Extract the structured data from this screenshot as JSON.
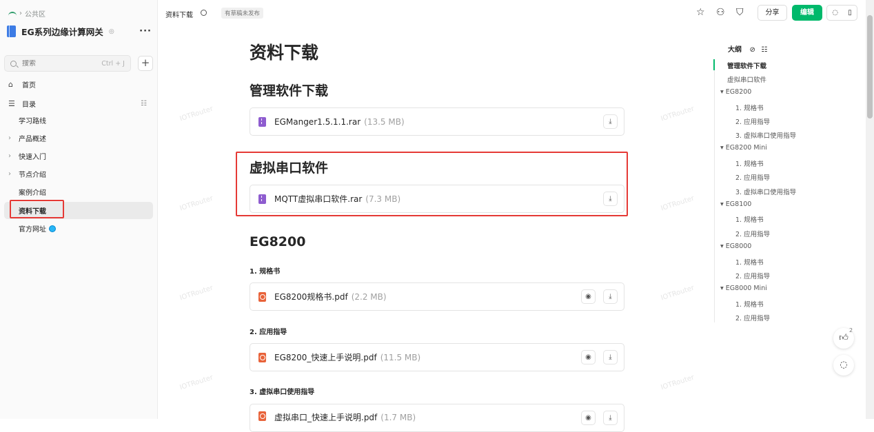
{
  "breadcrumb": {
    "workspace": "公共区"
  },
  "kb": {
    "name": "EG系列边缘计算网关",
    "more": "···"
  },
  "search": {
    "placeholder": "搜索",
    "shortcut": "Ctrl + J"
  },
  "nav": {
    "home": "首页",
    "toc": "目录"
  },
  "tree": [
    {
      "label": "学习路线",
      "arrow": ""
    },
    {
      "label": "产品概述",
      "arrow": "›"
    },
    {
      "label": "快速入门",
      "arrow": "›"
    },
    {
      "label": "节点介绍",
      "arrow": "›"
    },
    {
      "label": "案例介绍",
      "arrow": ""
    },
    {
      "label": "资料下载",
      "arrow": ""
    },
    {
      "label": "官方网址",
      "arrow": ""
    }
  ],
  "topbar": {
    "doc_title": "资料下载",
    "draft_badge": "有草稿未发布",
    "share": "分享",
    "edit": "编辑"
  },
  "content": {
    "title": "资料下载",
    "sections": {
      "mgmt": "管理软件下载",
      "serial": "虚拟串口软件",
      "eg8200": "EG8200"
    },
    "subsections": {
      "spec": "1. 规格书",
      "guide": "2. 应用指导",
      "serial_guide": "3. 虚拟串口使用指导"
    },
    "files": [
      {
        "name": "EGManger1.5.1.1.rar",
        "size": "(13.5 MB)"
      },
      {
        "name": "MQTT虚拟串口软件.rar",
        "size": "(7.3 MB)"
      },
      {
        "name": "EG8200规格书.pdf",
        "size": "(2.2 MB)"
      },
      {
        "name": "EG8200_快速上手说明.pdf",
        "size": "(11.5 MB)"
      },
      {
        "name": "虚拟串口_快速上手说明.pdf",
        "size": "(1.7 MB)"
      }
    ],
    "watermark": "IOTRouter"
  },
  "outline": {
    "title": "大纲",
    "items": [
      "管理软件下载",
      "虚拟串口软件",
      "EG8200",
      "1. 规格书",
      "2. 应用指导",
      "3. 虚拟串口使用指导",
      "EG8200 Mini",
      "1. 规格书",
      "2. 应用指导",
      "3. 虚拟串口使用指导",
      "EG8100",
      "1. 规格书",
      "2. 应用指导",
      "EG8000",
      "1. 规格书",
      "2. 应用指导",
      "EG8000 Mini",
      "1. 规格书",
      "2. 应用指导"
    ]
  },
  "likes": "2",
  "colors": {
    "accent": "#00b96b",
    "highlight_box": "#e53935"
  }
}
